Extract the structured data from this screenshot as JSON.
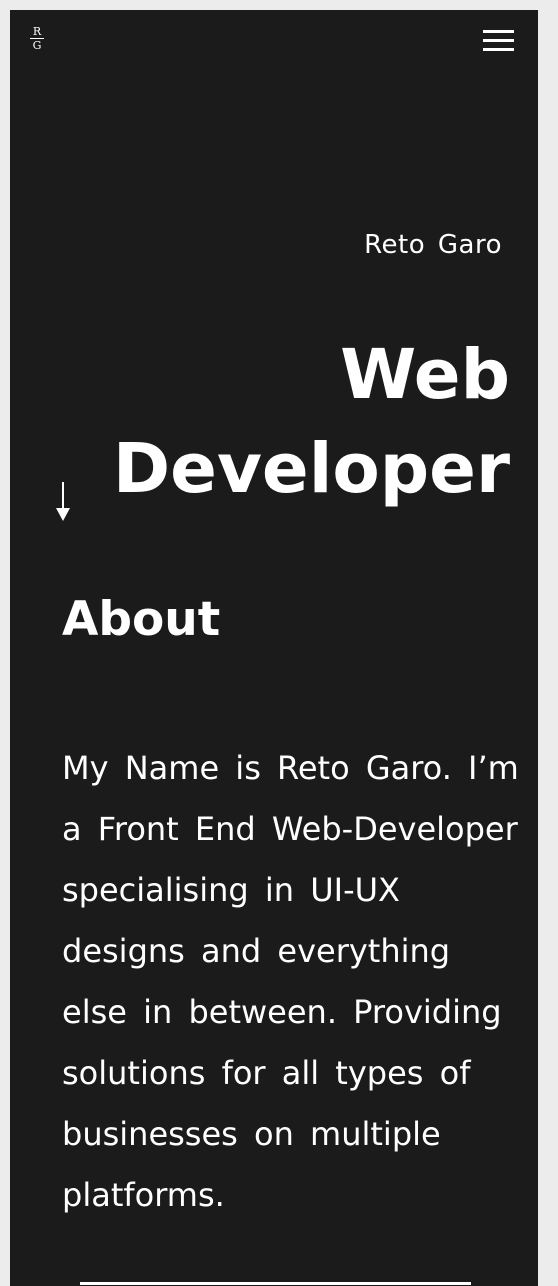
{
  "logo": {
    "top_letter": "R",
    "bottom_letter": "G"
  },
  "header": {
    "menu_icon": "hamburger-menu-icon"
  },
  "hero": {
    "name": "Reto Garo",
    "title_line1": "Web",
    "title_line2": "Developer",
    "scroll_icon": "arrow-down-icon"
  },
  "about": {
    "heading": "About",
    "text": "My Name is Reto Garo. I’m a Front End Web-Developer specialising in UI-UX designs and everything else in between. Providing solutions for all types of businesses on multiple platforms."
  },
  "colors": {
    "background": "#1b1b1c",
    "foreground": "#ffffff",
    "outer": "#ececec"
  }
}
